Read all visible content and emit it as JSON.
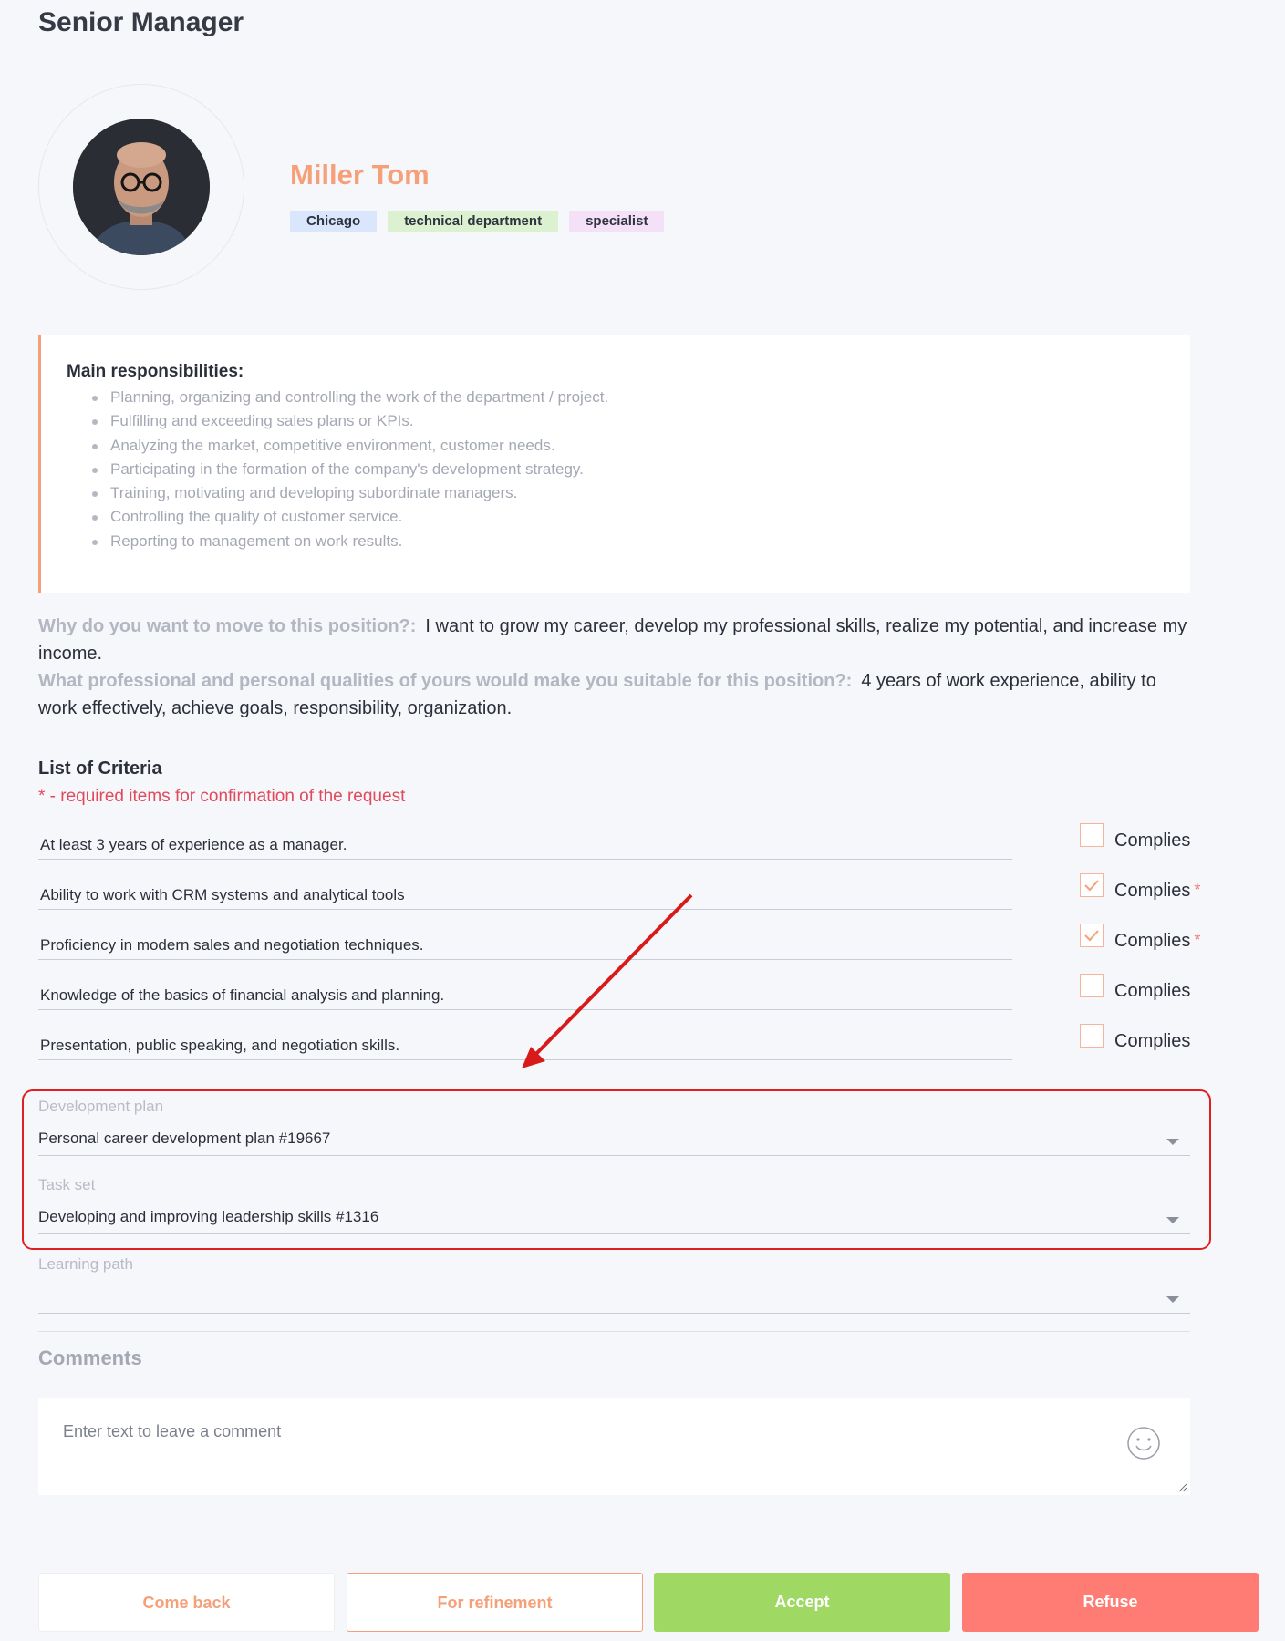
{
  "page": {
    "title": "Senior Manager"
  },
  "profile": {
    "name": "Miller Tom",
    "tags": {
      "city": "Chicago",
      "department": "technical department",
      "role": "specialist"
    }
  },
  "responsibilities": {
    "title": "Main responsibilities:",
    "items": [
      "Planning, organizing and controlling the work of the department / project.",
      "Fulfilling and exceeding sales plans or KPIs.",
      "Analyzing the market, competitive environment, customer needs.",
      "Participating in the formation of the company's development strategy.",
      "Training, motivating and developing subordinate managers.",
      "Controlling the quality of customer service.",
      "Reporting to management on work results."
    ]
  },
  "qa": {
    "q1": "Why do you want to move to this position?:",
    "a1": "I want to grow my career, develop my professional skills, realize my potential, and increase my income.",
    "q2": "What professional and personal qualities of yours would make you suitable for this position?:",
    "a2": "4 years of work experience, ability to work effectively, achieve goals, responsibility, organization."
  },
  "criteria": {
    "title": "List of Criteria",
    "note": "* - required items for confirmation of the request",
    "check_label": "Complies",
    "required_mark": "*",
    "items": [
      {
        "text": "At least 3 years of experience as a manager.",
        "checked": false,
        "required": false
      },
      {
        "text": "Ability to work with CRM systems and analytical tools",
        "checked": true,
        "required": true
      },
      {
        "text": "Proficiency in modern sales and negotiation techniques.",
        "checked": true,
        "required": true
      },
      {
        "text": "Knowledge of the basics of financial analysis and planning.",
        "checked": false,
        "required": false
      },
      {
        "text": "Presentation, public speaking, and negotiation skills.",
        "checked": false,
        "required": false
      }
    ]
  },
  "fields": {
    "development_plan": {
      "label": "Development plan",
      "value": "Personal career development plan #19667"
    },
    "task_set": {
      "label": "Task set",
      "value": "Developing and improving leadership skills #1316"
    },
    "learning_path": {
      "label": "Learning path",
      "value": ""
    }
  },
  "comments": {
    "title": "Comments",
    "placeholder": "Enter text to leave a comment"
  },
  "buttons": {
    "back": "Come back",
    "refinement": "For refinement",
    "accept": "Accept",
    "refuse": "Refuse"
  },
  "colors": {
    "accent": "#f6a07a",
    "accept": "#a0d864",
    "refuse": "#ff7c74",
    "annotation": "#e02020"
  }
}
